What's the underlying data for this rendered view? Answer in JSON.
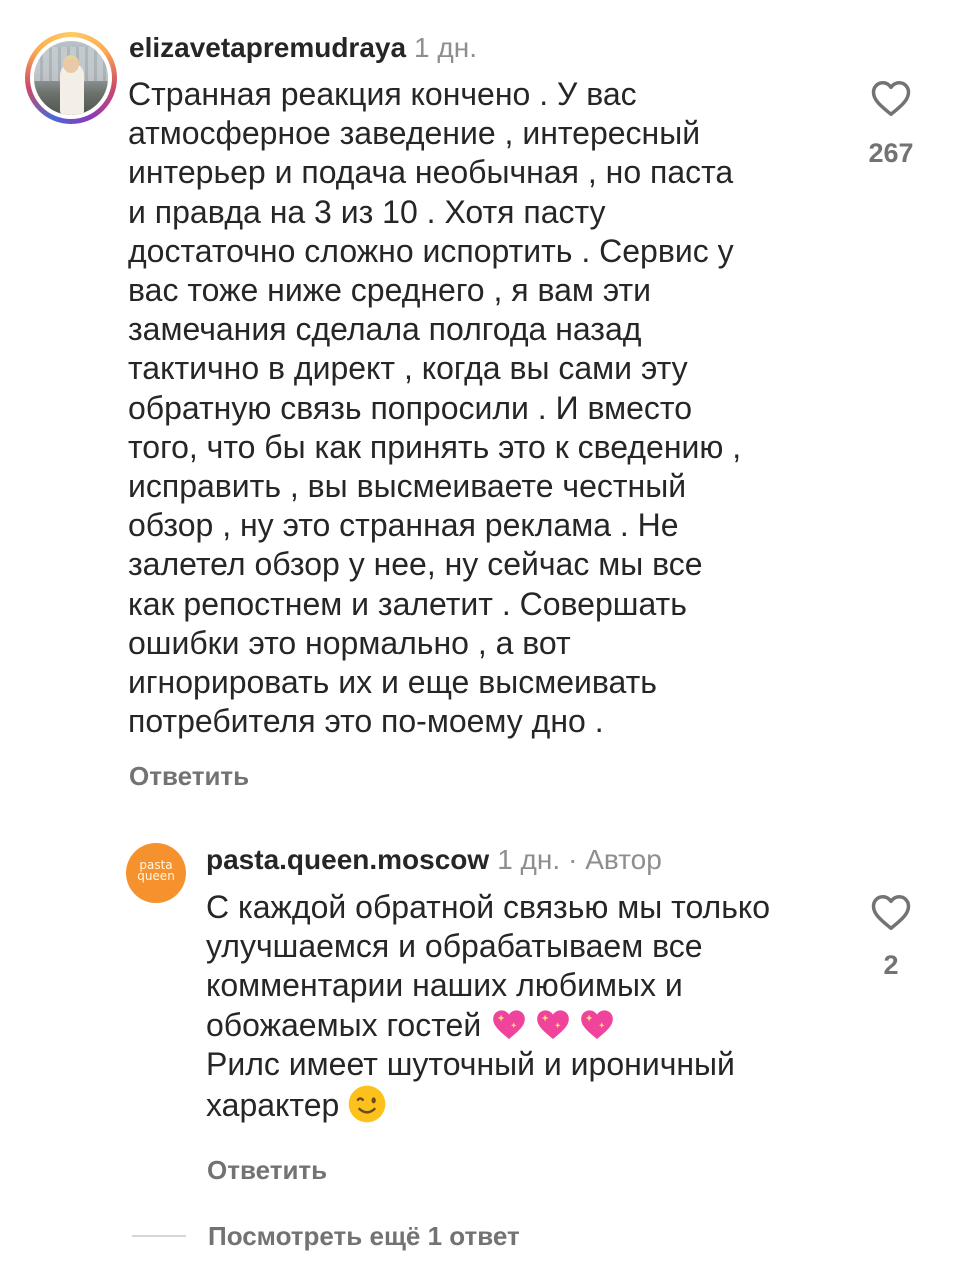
{
  "comment": {
    "username": "elizavetapremudraya",
    "time": "1 дн.",
    "text": "Странная реакция кончено . У вас\nатмосферное заведение , интересный\nинтерьер и подача необычная , но паста\nи правда на 3 из 10 . Хотя пасту\nдостаточно сложно испортить . Сервис у\nвас тоже ниже среднего , я вам эти\nзамечания сделала полгода назад\nтактично в директ , когда вы сами эту\nобратную связь попросили . И вместо\nтого, что бы как принять это к сведению ,\nисправить , вы высмеиваете честный\nобзор , ну это странная реклама . Не\nзалетел обзор у нее, ну сейчас мы все\nкак репостнем и залетит . Совершать\nошибки это нормально , а вот\nигнорировать их и еще высмеивать\nпотребителя это по-моему дно .",
    "reply_label": "Ответить",
    "likes": "267",
    "like_icon": "heart-outline-icon"
  },
  "reply": {
    "username": "pasta.queen.moscow",
    "time": "1 дн.",
    "author_badge": "· Автор",
    "avatar_text_1": "pasta",
    "avatar_text_2": "queen",
    "avatar_color": "#f6922d",
    "text_1": "С каждой обратной связью мы только улучшаемся и обрабатываем все комментарии наших любимых и обожаемых гостей",
    "emoji_1": "sparkling-heart-emoji",
    "text_2": "Рилс имеет шуточный и ироничный характер",
    "emoji_2": "winking-face-emoji",
    "reply_label": "Ответить",
    "likes": "2",
    "like_icon": "heart-outline-icon"
  },
  "more_replies_label": "Посмотреть ещё 1 ответ"
}
